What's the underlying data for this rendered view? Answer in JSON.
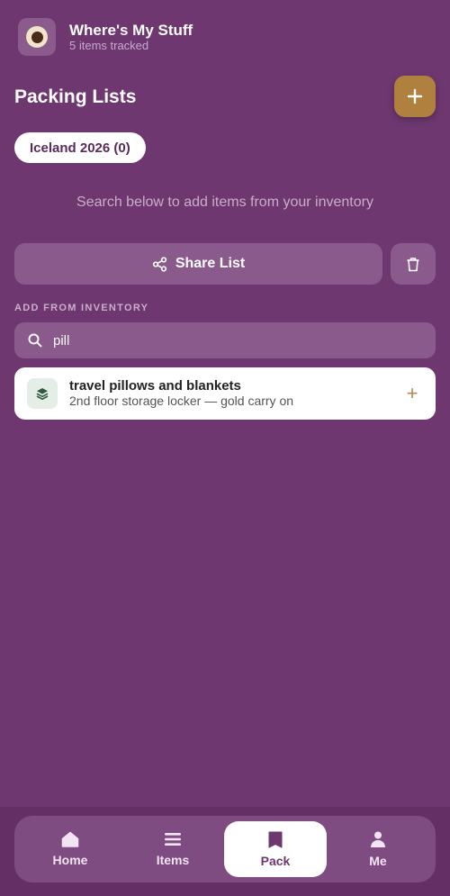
{
  "header": {
    "title": "Where's My Stuff",
    "subtitle": "5 items tracked"
  },
  "page": {
    "title": "Packing Lists",
    "active_list_chip": "Iceland 2026 (0)",
    "hint": "Search below to add items from your inventory"
  },
  "actions": {
    "share_label": "Share List"
  },
  "inventory": {
    "section_label": "ADD FROM INVENTORY",
    "search_value": "pill",
    "results": [
      {
        "name": "travel pillows and blankets",
        "location": "2nd floor storage locker — gold carry on",
        "icon": "layers-icon"
      }
    ]
  },
  "tabs": [
    {
      "label": "Home",
      "icon": "home-icon"
    },
    {
      "label": "Items",
      "icon": "list-icon"
    },
    {
      "label": "Pack",
      "icon": "bookmark-icon",
      "active": true
    },
    {
      "label": "Me",
      "icon": "person-icon"
    }
  ],
  "colors": {
    "background": "#6e3770",
    "accent": "#b0803f",
    "surface": "#8b5a8d"
  }
}
